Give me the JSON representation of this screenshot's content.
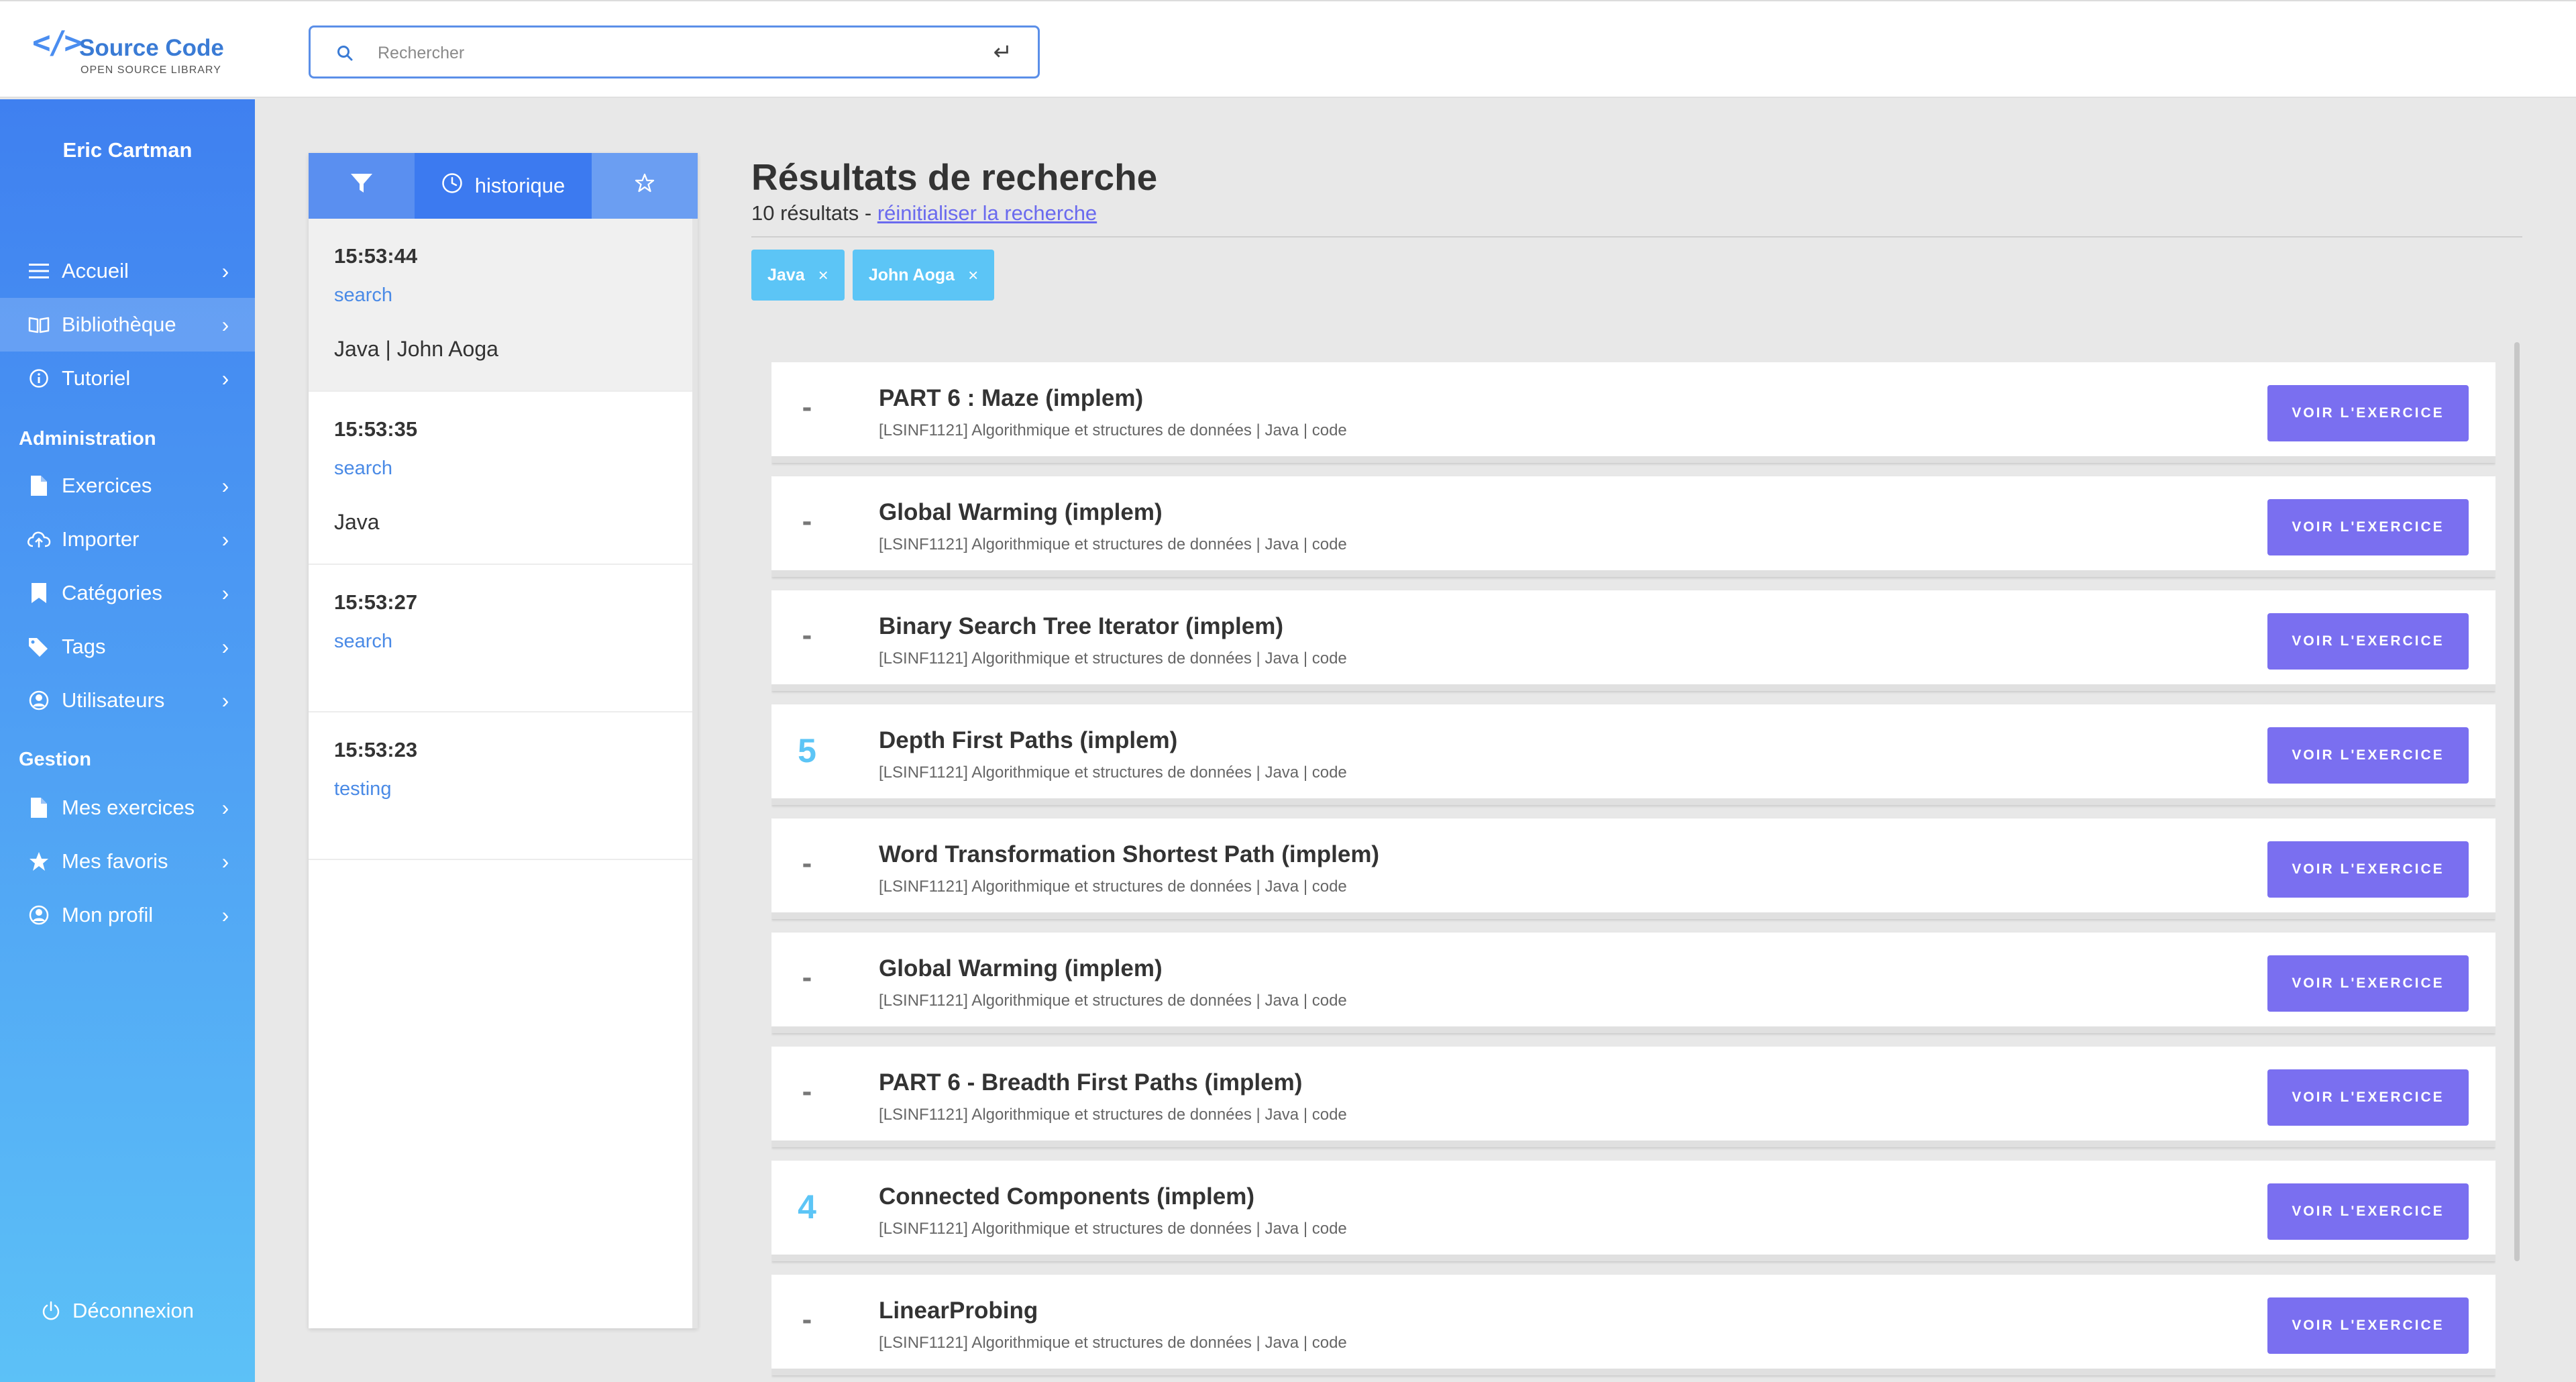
{
  "app": {
    "logo_mark": "</>",
    "title": "Source Code",
    "subtitle": "OPEN SOURCE LIBRARY"
  },
  "search": {
    "placeholder": "Rechercher",
    "enter_symbol": "↵"
  },
  "sidebar": {
    "user_name": "Eric Cartman",
    "main_items": [
      {
        "label": "Accueil",
        "icon": "menu-icon"
      },
      {
        "label": "Bibliothèque",
        "icon": "book-icon",
        "active": true
      },
      {
        "label": "Tutoriel",
        "icon": "info-icon"
      }
    ],
    "admin_title": "Administration",
    "admin_items": [
      {
        "label": "Exercices",
        "icon": "file-icon"
      },
      {
        "label": "Importer",
        "icon": "cloud-upload-icon"
      },
      {
        "label": "Catégories",
        "icon": "bookmark-icon"
      },
      {
        "label": "Tags",
        "icon": "tags-icon"
      },
      {
        "label": "Utilisateurs",
        "icon": "user-circle-icon"
      }
    ],
    "gestion_title": "Gestion",
    "gestion_items": [
      {
        "label": "Mes exercices",
        "icon": "file-icon"
      },
      {
        "label": "Mes favoris",
        "icon": "star-icon"
      },
      {
        "label": "Mon profil",
        "icon": "user-circle-icon"
      }
    ],
    "logout_label": "Déconnexion"
  },
  "history": {
    "tabs": [
      {
        "icon": "filter-icon",
        "label": ""
      },
      {
        "icon": "clock-icon",
        "label": "historique"
      },
      {
        "icon": "star-icon",
        "label": ""
      }
    ],
    "entries": [
      {
        "time": "15:53:44",
        "type": "search",
        "query": "Java | John Aoga",
        "selected": true
      },
      {
        "time": "15:53:35",
        "type": "search",
        "query": "Java"
      },
      {
        "time": "15:53:27",
        "type": "search",
        "query": ""
      },
      {
        "time": "15:53:23",
        "type": "testing",
        "query": ""
      }
    ]
  },
  "results": {
    "title": "Résultats de recherche",
    "count_text": "10 résultats - ",
    "reset_label": "réinitialiser la recherche",
    "chips": [
      "Java",
      "John Aoga"
    ],
    "chip_close": "×",
    "button_label": "VOIR L'EXERCICE",
    "items": [
      {
        "score": "-",
        "title": "PART 6 : Maze (implem)",
        "meta": "[LSINF1121] Algorithmique et structures de données | Java | code"
      },
      {
        "score": "-",
        "title": "Global Warming (implem)",
        "meta": "[LSINF1121] Algorithmique et structures de données | Java | code"
      },
      {
        "score": "-",
        "title": "Binary Search Tree Iterator (implem)",
        "meta": "[LSINF1121] Algorithmique et structures de données | Java | code"
      },
      {
        "score": "5",
        "title": "Depth First Paths (implem)",
        "meta": "[LSINF1121] Algorithmique et structures de données | Java | code"
      },
      {
        "score": "-",
        "title": "Word Transformation Shortest Path (implem)",
        "meta": "[LSINF1121] Algorithmique et structures de données | Java | code"
      },
      {
        "score": "-",
        "title": "Global Warming (implem)",
        "meta": "[LSINF1121] Algorithmique et structures de données | Java | code"
      },
      {
        "score": "-",
        "title": "PART 6 - Breadth First Paths (implem)",
        "meta": "[LSINF1121] Algorithmique et structures de données | Java | code"
      },
      {
        "score": "4",
        "title": "Connected Components (implem)",
        "meta": "[LSINF1121] Algorithmique et structures de données | Java | code"
      },
      {
        "score": "-",
        "title": "LinearProbing",
        "meta": "[LSINF1121] Algorithmique et structures de données | Java | code"
      }
    ]
  },
  "colors": {
    "accent": "#3c7af0",
    "button": "#7a6ff0",
    "chip": "#5cc5f6",
    "link": "#6a6aee"
  }
}
